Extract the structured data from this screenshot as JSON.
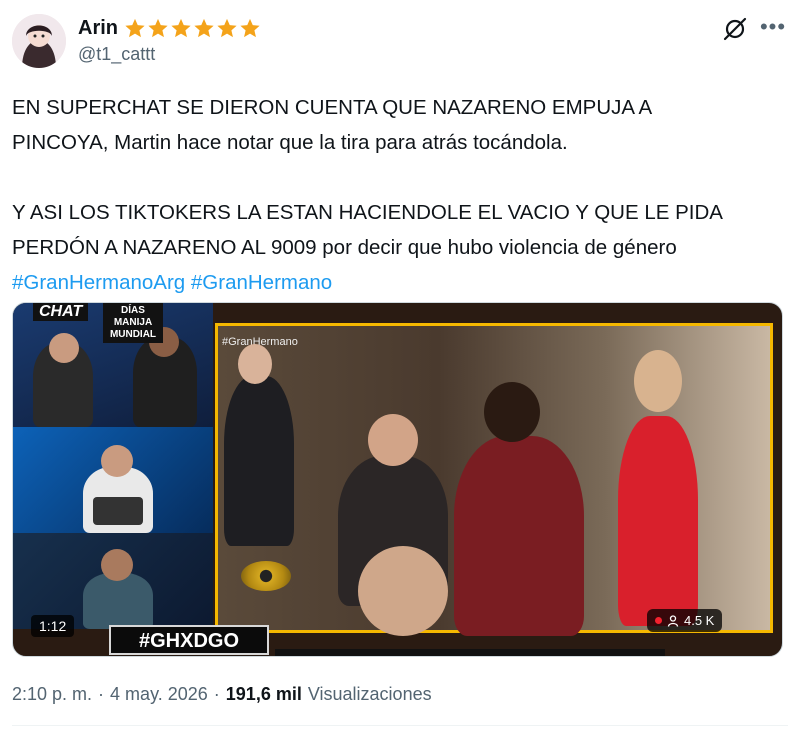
{
  "author": {
    "name": "Arin",
    "handle": "@t1_cattt",
    "badge_emojis": "★★★★★★"
  },
  "tweet": {
    "para1_line1": "EN SUPERCHAT SE DIERON CUENTA QUE NAZARENO EMPUJA A",
    "para1_line2": "PINCOYA, Martin hace notar que la tira para atrás tocándola.",
    "para2_line1": "Y ASI LOS TIKTOKERS LA ESTAN HACIENDOLE EL VACIO Y QUE LE PIDA",
    "para2_line2": "PERDÓN A NAZARENO AL 9009 por decir que hubo violencia de género",
    "hashtag1": "#GranHermanoArg",
    "hashtag2": "#GranHermano"
  },
  "media": {
    "duration": "1:12",
    "viewers": "4.5 K",
    "banner_hashtag": "#GHXDGO",
    "chat_label": "CHAT",
    "dias_label": "DÍAS MANIJA MUNDIAL",
    "watermark": "#GranHermano"
  },
  "meta": {
    "time": "2:10 p. m.",
    "separator": "·",
    "date": "4 may. 2026",
    "views_count": "191,6 mil",
    "views_label": "Visualizaciones"
  },
  "colors": {
    "hashtag": "#1d9bf0",
    "secondary_text": "#536471",
    "star": "#f4a31a",
    "live": "#f4212e"
  },
  "icons": {
    "grok": "grok-icon",
    "more": "more-icon",
    "person": "person-icon"
  }
}
